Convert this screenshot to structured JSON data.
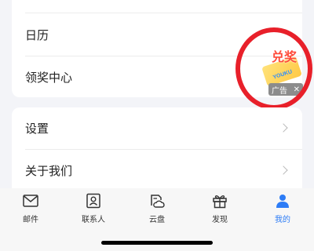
{
  "menu_top": {
    "items": [
      {
        "label": "日历"
      },
      {
        "label": "领奖中心"
      }
    ]
  },
  "menu_bottom": {
    "items": [
      {
        "label": "设置"
      },
      {
        "label": "关于我们"
      }
    ]
  },
  "ad": {
    "headline": "兑奖",
    "brand": "YOUKU",
    "badge_label": "广告",
    "close_symbol": "✕",
    "highlight_color": "#e8202a"
  },
  "tabbar": {
    "tabs": [
      {
        "label": "邮件",
        "icon": "mail-icon",
        "active": false
      },
      {
        "label": "联系人",
        "icon": "contacts-icon",
        "active": false
      },
      {
        "label": "云盘",
        "icon": "cloud-drive-icon",
        "active": false
      },
      {
        "label": "发现",
        "icon": "gift-icon",
        "active": false
      },
      {
        "label": "我的",
        "icon": "person-icon",
        "active": true
      }
    ],
    "active_color": "#2d7cf6"
  }
}
